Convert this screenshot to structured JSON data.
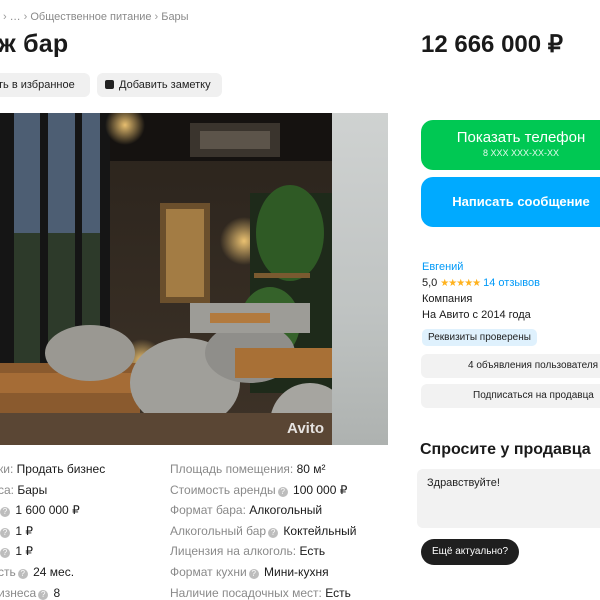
{
  "breadcrumb": {
    "items": [
      "…",
      "Общественное питание",
      "Бары"
    ],
    "sep": "›"
  },
  "title": "ж бар",
  "price": "12 666 000 ₽",
  "actions": {
    "favorite": "ть в избранное",
    "note": "Добавить заметку"
  },
  "photo": {
    "watermark": "Avito"
  },
  "cta": {
    "phone_label": "Показать телефон",
    "phone_masked": "8 XXX XXX-XX-XX",
    "message_label": "Написать сообщение"
  },
  "seller": {
    "name": "Евгений",
    "rating": "5,0",
    "stars": "★★★★★",
    "reviews": "14 отзывов",
    "type": "Компания",
    "since": "На Авито с 2014 года",
    "verified": "Реквизиты проверены"
  },
  "seller_buttons": {
    "ads": "4 объявления пользователя",
    "subscribe": "Подписаться на продавца"
  },
  "ask": {
    "title": "Спросите у продавца",
    "input_value": "Здравствуйте!",
    "quick_reply": "Ещё актуально?"
  },
  "params_left": [
    {
      "label": "ки:",
      "value": "Продать бизнес",
      "help": false
    },
    {
      "label": "са:",
      "value": "Бары",
      "help": false
    },
    {
      "label": "",
      "value": "1 600 000 ₽",
      "help": true
    },
    {
      "label": "",
      "value": "1 ₽",
      "help": true
    },
    {
      "label": "",
      "value": "1 ₽",
      "help": true
    },
    {
      "label": "сть",
      "value": "24 мес.",
      "help": true
    },
    {
      "label": "изнеса",
      "value": "8",
      "help": true
    }
  ],
  "params_right": [
    {
      "label": "Площадь помещения:",
      "value": "80 м²",
      "help": false
    },
    {
      "label": "Стоимость аренды",
      "value": "100 000 ₽",
      "help": true
    },
    {
      "label": "Формат бара:",
      "value": "Алкогольный",
      "help": false
    },
    {
      "label": "Алкогольный бар",
      "value": "Коктейльный",
      "help": true
    },
    {
      "label": "Лицензия на алкоголь:",
      "value": "Есть",
      "help": false
    },
    {
      "label": "Формат кухни",
      "value": "Мини-кухня",
      "help": true
    },
    {
      "label": "Наличие посадочных мест:",
      "value": "Есть",
      "help": false
    }
  ],
  "colors": {
    "green": "#00c853",
    "blue": "#00aaff",
    "link": "#0099f7",
    "star": "#ffb21e"
  }
}
